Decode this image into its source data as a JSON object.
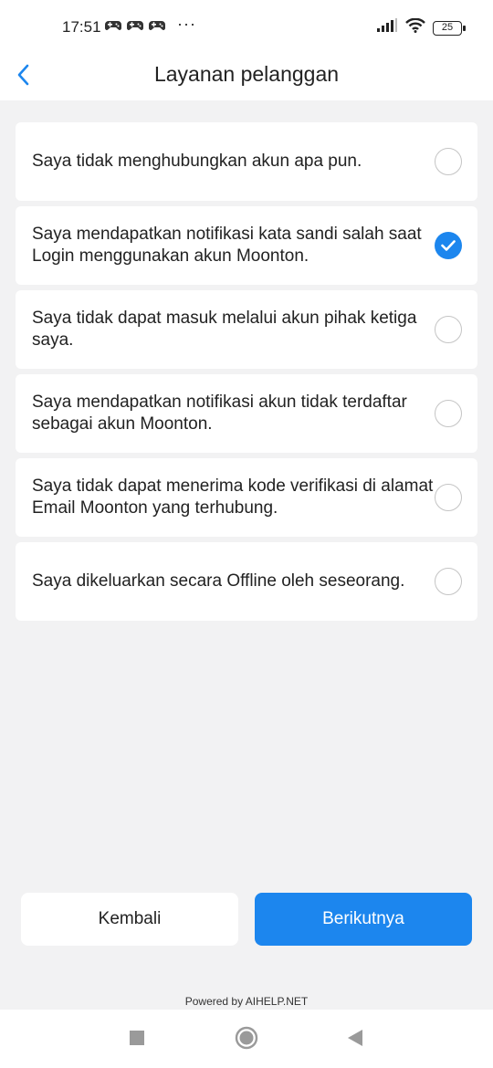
{
  "status_bar": {
    "time": "17:51",
    "more": "···",
    "battery": "25",
    "icons": [
      "gamepad-icon",
      "gamepad-icon",
      "gamepad-icon",
      "signal-icon",
      "wifi-icon",
      "battery-icon"
    ]
  },
  "header": {
    "title": "Layanan pelanggan",
    "back_icon": "chevron-left-icon"
  },
  "options": [
    {
      "label": "Saya tidak menghubungkan akun apa pun.",
      "checked": false
    },
    {
      "label": "Saya mendapatkan notifikasi kata sandi salah saat Login menggunakan akun Moonton.",
      "checked": true
    },
    {
      "label": "Saya tidak dapat masuk melalui akun pihak ketiga saya.",
      "checked": false
    },
    {
      "label": "Saya mendapatkan notifikasi akun tidak terdaftar sebagai akun Moonton.",
      "checked": false
    },
    {
      "label": "Saya tidak dapat menerima kode verifikasi di alamat Email Moonton yang terhubung.",
      "checked": false
    },
    {
      "label": "Saya dikeluarkan secara Offline oleh seseorang.",
      "checked": false
    }
  ],
  "buttons": {
    "back_label": "Kembali",
    "next_label": "Berikutnya"
  },
  "footer": {
    "powered_by": "Powered by AIHELP.NET"
  },
  "colors": {
    "accent": "#1c86ee",
    "background": "#f2f2f3",
    "card": "#ffffff"
  }
}
